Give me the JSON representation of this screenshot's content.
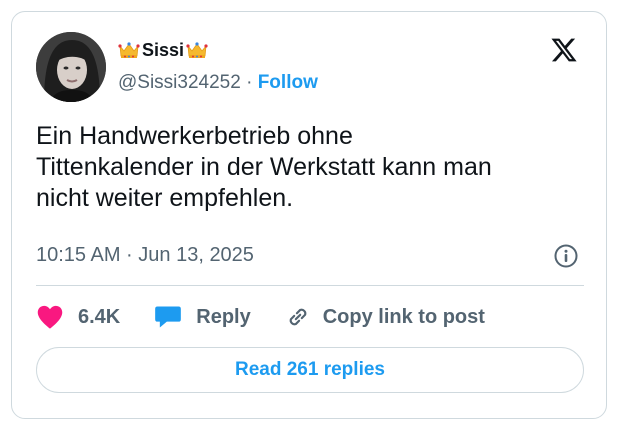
{
  "colors": {
    "accent": "#1d9bf0",
    "like": "#f91880",
    "muted": "#536471",
    "text": "#0f1419",
    "border": "#cfd9de"
  },
  "author": {
    "display_name": "Sissi",
    "display_emoji": "crown-emoji",
    "handle": "@Sissi324252",
    "separator": "·",
    "follow_label": "Follow"
  },
  "tweet": {
    "text": "Ein Handwerkerbetrieb ohne\nTittenkalender in der Werkstatt kann man\nnicht weiter empfehlen.",
    "timestamp": "10:15 AM · Jun 13, 2025"
  },
  "actions": {
    "like_count": "6.4K",
    "reply_label": "Reply",
    "copy_label": "Copy link to post",
    "read_replies_label": "Read 261 replies"
  },
  "icons": [
    "x-logo-icon",
    "info-icon",
    "heart-icon",
    "speech-bubble-icon",
    "link-icon",
    "crown-icon"
  ]
}
